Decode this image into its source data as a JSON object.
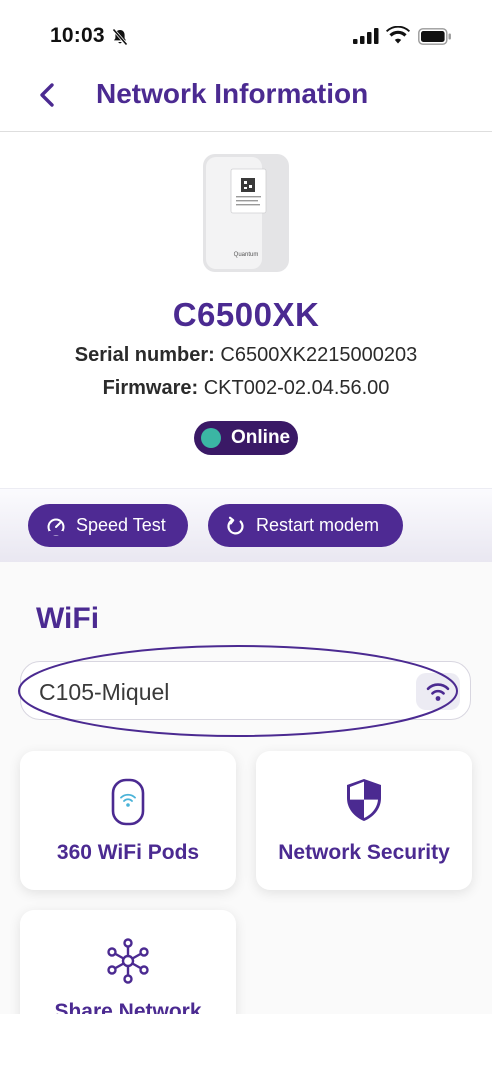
{
  "status_bar": {
    "time": "10:03"
  },
  "header": {
    "title": "Network Information"
  },
  "device": {
    "image_brand": "Quantum",
    "model": "C6500XK",
    "serial_label": "Serial number:",
    "serial_value": "C6500XK2215000203",
    "firmware_label": "Firmware:",
    "firmware_value": "CKT002-02.04.56.00",
    "status": "Online",
    "status_color": "#3bb6a4"
  },
  "actions": {
    "speed_test": "Speed Test",
    "restart": "Restart modem"
  },
  "wifi": {
    "heading": "WiFi",
    "ssid": "C105-Miquel"
  },
  "cards": {
    "pods": "360 WiFi Pods",
    "security": "Network Security",
    "share": "Share Network"
  },
  "colors": {
    "brand": "#4b2a91",
    "badge_bg": "#3a1966"
  }
}
